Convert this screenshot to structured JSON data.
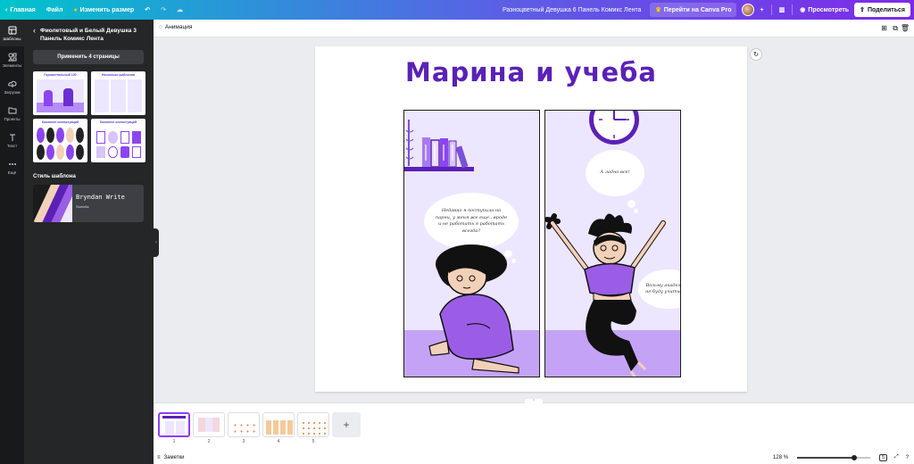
{
  "topbar": {
    "home": "Главная",
    "file": "Файл",
    "resize": "Изменить размер",
    "doc_title": "Разноцветный Девушка 6 Панель Комикс Лента",
    "pro_button": "Перейти на Canva Pro",
    "preview": "Просмотреть",
    "share": "Поделиться"
  },
  "rail": {
    "items": [
      {
        "label": "Шаблоны",
        "icon": "templates-icon"
      },
      {
        "label": "Элементы",
        "icon": "elements-icon"
      },
      {
        "label": "Загрузки",
        "icon": "uploads-icon"
      },
      {
        "label": "Проекты",
        "icon": "projects-icon"
      },
      {
        "label": "Текст",
        "icon": "text-icon"
      },
      {
        "label": "Ещё",
        "icon": "more-icon"
      }
    ]
  },
  "panel": {
    "title": "Фиолетовый и Белый Девушка 3 Панель Комикс Лента",
    "apply_button": "Применить 4 страницы",
    "thumbs": [
      {
        "caption": "Горизонтальный 100"
      },
      {
        "caption": "Несколько шаблонов"
      },
      {
        "caption": "Комплект иллюстраций"
      },
      {
        "caption": "Комплект иллюстраций"
      }
    ],
    "style_heading": "Стиль шаблона",
    "style_font": "Bryndan Write",
    "style_sub": "Somelia"
  },
  "editor": {
    "animation": "Анимация"
  },
  "comic": {
    "title": "Марина и учеба",
    "bubble1": "Недавно я поступила на парни, у меня же еще...вроде и не работать я работать всегда?",
    "bubble2": "А ладно все!",
    "bubble3": "Возьму академ и не буду учиться."
  },
  "pages": {
    "numbers": [
      "1",
      "2",
      "3",
      "4",
      "5"
    ],
    "add_label": "+"
  },
  "bottom": {
    "notes": "Заметки",
    "zoom": "128 %",
    "zoom_level": 0.78,
    "page_count": "5"
  },
  "colors": {
    "brand_purple": "#7d2ae8",
    "comic_purple": "#5b21b6",
    "figure_purple": "#9b5de5",
    "panel_bg": "#ece7fe",
    "floor": "#c4a3f7"
  }
}
